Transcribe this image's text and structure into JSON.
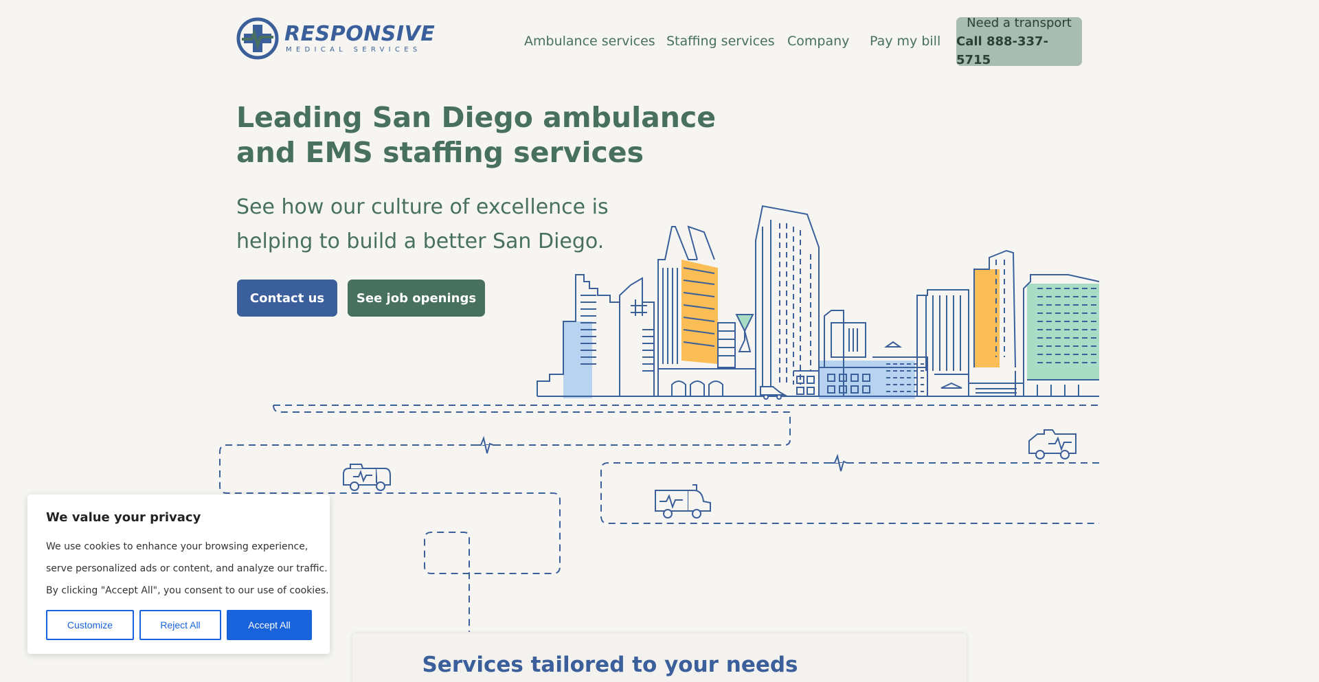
{
  "brand": {
    "name": "RESPONSIVE",
    "tagline": "MEDICAL SERVICES",
    "colors": {
      "blue": "#3a5f9b",
      "green": "#48705e",
      "background": "#f6f5f1",
      "cta": "#a8bcb2",
      "cookie_accent": "#1863dc"
    }
  },
  "nav": {
    "items": [
      {
        "label": "Ambulance services"
      },
      {
        "label": "Staffing services"
      },
      {
        "label": "Company"
      },
      {
        "label": "Pay my bill"
      }
    ],
    "cta": {
      "line1": "Need a transport",
      "line2": "Call 888-337-5715"
    }
  },
  "hero": {
    "title_line1": "Leading San Diego ambulance",
    "title_line2": "and EMS staffing services",
    "subtitle_line1": "See how our culture of excellence is",
    "subtitle_line2": "helping to build a better San Diego.",
    "contact_label": "Contact us",
    "jobs_label": "See job openings"
  },
  "services": {
    "title": "Services tailored to your needs"
  },
  "cookie": {
    "title": "We value your privacy",
    "text_line1": "We use cookies to enhance your browsing experience,",
    "text_line2": "serve personalized ads or content, and analyze our traffic.",
    "text_line3": "By clicking \"Accept All\", you consent to our use of cookies.",
    "customize_label": "Customize",
    "reject_label": "Reject All",
    "accept_label": "Accept All"
  },
  "icons": [
    "logo-cross-icon",
    "skyline-illustration",
    "ambulance-icon",
    "heartbeat-icon"
  ]
}
